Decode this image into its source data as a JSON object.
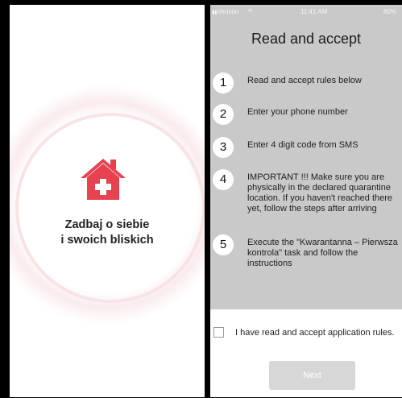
{
  "left_screen": {
    "tagline_line1": "Zadbaj o siebie",
    "tagline_line2": "i swoich bliskich",
    "icon": "house-medical-icon",
    "accent_color": "#e8414f"
  },
  "right_screen": {
    "status_bar": {
      "carrier": "Verizon",
      "wifi_icon": "wifi-icon",
      "time": "11:41 AM",
      "battery": "80%"
    },
    "title": "Read and accept",
    "steps": [
      {
        "number": "1",
        "lines": [
          "Read and accept rules below"
        ]
      },
      {
        "number": "2",
        "lines": [
          "Enter your phone number"
        ]
      },
      {
        "number": "3",
        "lines": [
          "Enter 4 digit code from SMS"
        ]
      },
      {
        "number": "4",
        "lines": [
          "IMPORTANT !!! Make sure you are",
          "physically in the declared quarantine",
          "location. If you haven't reached there",
          "yet, follow the steps after arriving"
        ]
      },
      {
        "number": "5",
        "lines": [
          "Execute the \"Kwarantanna – Pierwsza",
          "kontrola\" task and follow the",
          "instructions"
        ]
      }
    ],
    "accept_label": "I have read and accept application rules.",
    "next_button": "Next",
    "background_color": "#c9c9c9"
  }
}
